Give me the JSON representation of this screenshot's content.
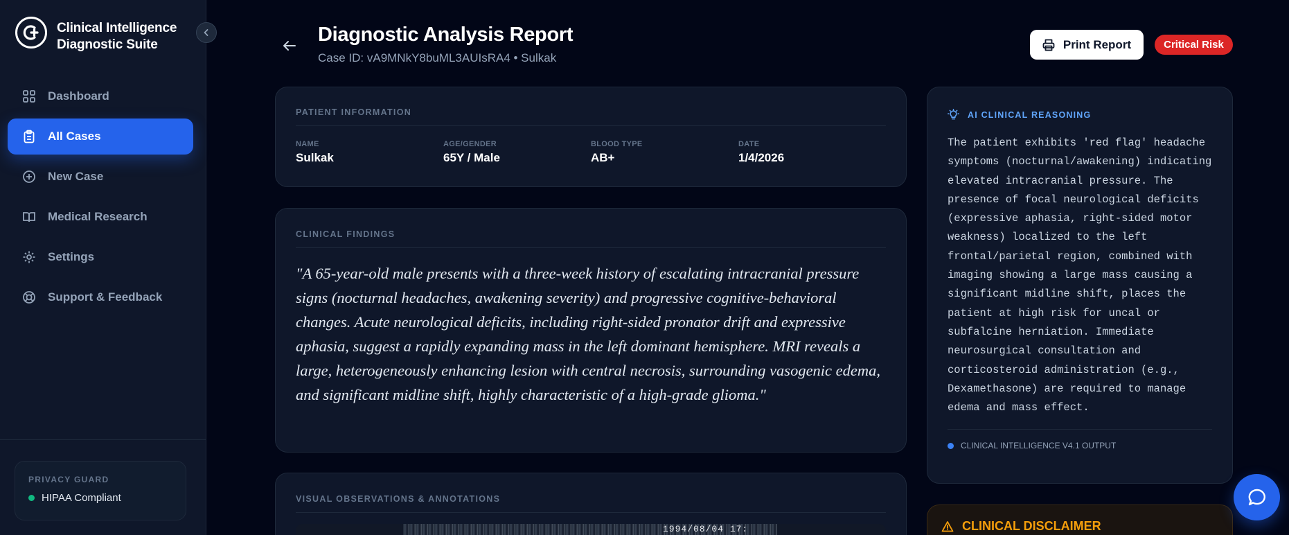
{
  "sidebar": {
    "brand_title": "Clinical Intelligence Diagnostic Suite",
    "items": [
      {
        "label": "Dashboard",
        "icon": "grid-icon"
      },
      {
        "label": "All Cases",
        "icon": "clipboard-icon",
        "active": true
      },
      {
        "label": "New Case",
        "icon": "plus-circle-icon"
      },
      {
        "label": "Medical Research",
        "icon": "book-icon"
      },
      {
        "label": "Settings",
        "icon": "gear-icon"
      },
      {
        "label": "Support & Feedback",
        "icon": "lifebuoy-icon"
      }
    ],
    "privacy": {
      "label": "PRIVACY GUARD",
      "status": "HIPAA Compliant",
      "status_color": "#10b981"
    }
  },
  "header": {
    "title": "Diagnostic Analysis Report",
    "subtitle": "Case ID: vA9MNkY8buML3AUIsRA4 • Sulkak",
    "print_label": "Print Report",
    "risk_label": "Critical Risk",
    "risk_color": "#dc2626"
  },
  "patient": {
    "section_label": "PATIENT INFORMATION",
    "fields": [
      {
        "label": "NAME",
        "value": "Sulkak"
      },
      {
        "label": "AGE/GENDER",
        "value": "65Y / Male"
      },
      {
        "label": "BLOOD TYPE",
        "value": "AB+"
      },
      {
        "label": "DATE",
        "value": "1/4/2026"
      }
    ]
  },
  "findings": {
    "section_label": "CLINICAL FINDINGS",
    "text": "\"A 65-year-old male presents with a three-week history of escalating intracranial pressure signs (nocturnal headaches, awakening severity) and progressive cognitive-behavioral changes. Acute neurological deficits, including right-sided pronator drift and expressive aphasia, suggest a rapidly expanding mass in the left dominant hemisphere. MRI reveals a large, heterogeneously enhancing lesion with central necrosis, surrounding vasogenic edema, and significant midline shift, highly characteristic of a high-grade glioma.\""
  },
  "visual": {
    "section_label": "VISUAL OBSERVATIONS & ANNOTATIONS",
    "scan_stamp": "1994/08/04 17:"
  },
  "reasoning": {
    "label": "AI CLINICAL REASONING",
    "text": "The patient exhibits 'red flag' headache symptoms (nocturnal/awakening) indicating elevated intracranial pressure. The presence of focal neurological deficits (expressive aphasia, right-sided motor weakness) localized to the left frontal/parietal region, combined with imaging showing a large mass causing a significant midline shift, places the patient at high risk for uncal or subfalcine herniation. Immediate neurosurgical consultation and corticosteroid administration (e.g., Dexamethasone) are required to manage edema and mass effect.",
    "footer": "CLINICAL INTELLIGENCE V4.1 OUTPUT"
  },
  "disclaimer": {
    "title": "CLINICAL DISCLAIMER"
  },
  "colors": {
    "accent": "#2563eb",
    "background": "#020617",
    "warning": "#f59e0b"
  }
}
